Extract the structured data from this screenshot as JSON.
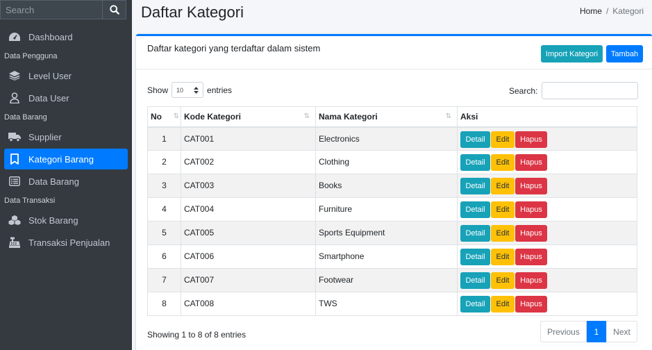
{
  "sidebar": {
    "search_placeholder": "Search",
    "items": [
      {
        "type": "item",
        "label": "Dashboard",
        "icon": "dashboard-icon"
      },
      {
        "type": "header",
        "label": "Data Pengguna"
      },
      {
        "type": "item",
        "label": "Level User",
        "icon": "layers-icon"
      },
      {
        "type": "item",
        "label": "Data User",
        "icon": "user-icon"
      },
      {
        "type": "header",
        "label": "Data Barang"
      },
      {
        "type": "item",
        "label": "Supplier",
        "icon": "truck-icon"
      },
      {
        "type": "item",
        "label": "Kategori Barang",
        "icon": "bookmark-icon",
        "active": true
      },
      {
        "type": "item",
        "label": "Data Barang",
        "icon": "list-icon"
      },
      {
        "type": "header",
        "label": "Data Transaksi"
      },
      {
        "type": "item",
        "label": "Stok Barang",
        "icon": "cubes-icon"
      },
      {
        "type": "item",
        "label": "Transaksi Penjualan",
        "icon": "cash-register-icon"
      }
    ]
  },
  "header": {
    "title": "Daftar Kategori",
    "breadcrumb": {
      "home": "Home",
      "separator": "/",
      "current": "Kategori"
    }
  },
  "card": {
    "title": "Daftar kategori yang terdaftar dalam sistem",
    "import_label": "Import Kategori",
    "add_label": "Tambah"
  },
  "table_controls": {
    "show_label": "Show",
    "length_value": "10",
    "entries_label": "entries",
    "search_label": "Search:"
  },
  "table": {
    "columns": [
      "No",
      "Kode Kategori",
      "Nama Kategori",
      "Aksi"
    ],
    "action_labels": {
      "detail": "Detail",
      "edit": "Edit",
      "delete": "Hapus"
    },
    "rows": [
      {
        "no": "1",
        "kode": "CAT001",
        "nama": "Electronics"
      },
      {
        "no": "2",
        "kode": "CAT002",
        "nama": "Clothing"
      },
      {
        "no": "3",
        "kode": "CAT003",
        "nama": "Books"
      },
      {
        "no": "4",
        "kode": "CAT004",
        "nama": "Furniture"
      },
      {
        "no": "5",
        "kode": "CAT005",
        "nama": "Sports Equipment"
      },
      {
        "no": "6",
        "kode": "CAT006",
        "nama": "Smartphone"
      },
      {
        "no": "7",
        "kode": "CAT007",
        "nama": "Footwear"
      },
      {
        "no": "8",
        "kode": "CAT008",
        "nama": "TWS"
      }
    ]
  },
  "footer": {
    "info": "Showing 1 to 8 of 8 entries",
    "previous": "Previous",
    "page": "1",
    "next": "Next"
  },
  "colors": {
    "sidebar_bg": "#343a40",
    "primary": "#007bff",
    "info": "#17a2b8",
    "warning": "#ffc107",
    "danger": "#dc3545"
  }
}
